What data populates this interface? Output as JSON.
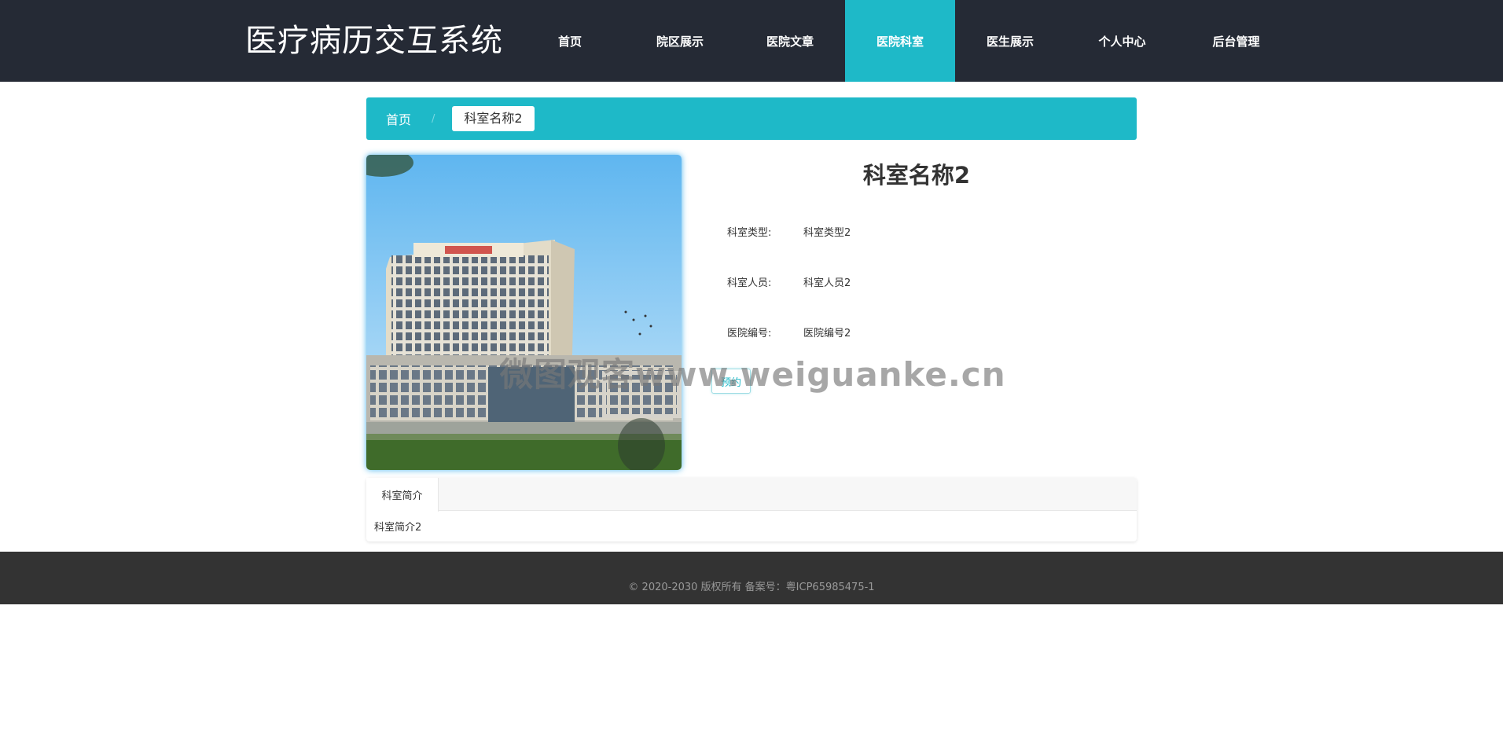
{
  "header": {
    "site_title": "医疗病历交互系统",
    "nav": [
      {
        "label": "首页"
      },
      {
        "label": "院区展示"
      },
      {
        "label": "医院文章"
      },
      {
        "label": "医院科室"
      },
      {
        "label": "医生展示"
      },
      {
        "label": "个人中心"
      },
      {
        "label": "后台管理"
      }
    ],
    "active_nav": "医院科室"
  },
  "breadcrumb": {
    "home": "首页",
    "separator": "/",
    "current": "科室名称2"
  },
  "detail": {
    "title": "科室名称2",
    "fields": [
      {
        "label": "科室类型:",
        "value": "科室类型2"
      },
      {
        "label": "科室人员:",
        "value": "科室人员2"
      },
      {
        "label": "医院编号:",
        "value": "医院编号2"
      }
    ],
    "book_button": "预约"
  },
  "watermark": "微图观客www.weiguanke.cn",
  "tabs": {
    "items": [
      {
        "label": "科室简介"
      }
    ],
    "content": "科室简介2"
  },
  "footer": {
    "text": "© 2020-2030 版权所有 备案号：粤ICP65985475-1"
  },
  "colors": {
    "header_bg": "#252a35",
    "accent": "#1eb9c8",
    "footer_bg": "#333333"
  }
}
